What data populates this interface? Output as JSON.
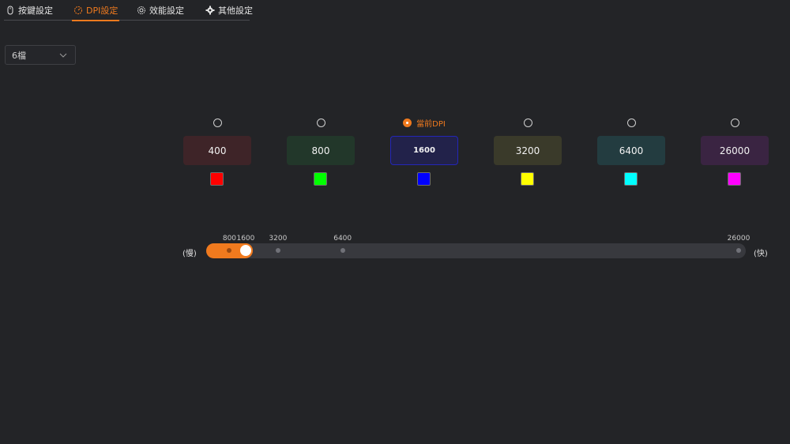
{
  "tabs": [
    {
      "label": "按鍵設定",
      "icon": "mouse-icon",
      "active": false
    },
    {
      "label": "DPI設定",
      "icon": "dpi-gauge-icon",
      "active": true
    },
    {
      "label": "效能設定",
      "icon": "performance-gear-icon",
      "active": false
    },
    {
      "label": "其他設定",
      "icon": "settings-gear-icon",
      "active": false
    }
  ],
  "dropdown": {
    "value": "6檔"
  },
  "current_label": "當前DPI",
  "stages": [
    {
      "value": "400",
      "bg": "#3e2428",
      "swatch": "#ff0000",
      "current": false
    },
    {
      "value": "800",
      "bg": "#22372a",
      "swatch": "#00ff00",
      "current": false
    },
    {
      "value": "1600",
      "bg": "#22224a",
      "swatch": "#0000ff",
      "current": true
    },
    {
      "value": "3200",
      "bg": "#3a3a2a",
      "swatch": "#ffff00",
      "current": false
    },
    {
      "value": "6400",
      "bg": "#233c40",
      "swatch": "#00ffff",
      "current": false
    },
    {
      "value": "26000",
      "bg": "#3a2442",
      "swatch": "#ff00ff",
      "current": false
    }
  ],
  "slider": {
    "slow_label": "(慢)",
    "fast_label": "(快)",
    "min": 0,
    "max": 26000,
    "value": 1600,
    "ticks": [
      {
        "value": 800,
        "label": "800"
      },
      {
        "value": 1600,
        "label": "1600"
      },
      {
        "value": 3200,
        "label": "3200"
      },
      {
        "value": 6400,
        "label": "6400"
      },
      {
        "value": 26000,
        "label": "26000"
      }
    ]
  },
  "colors": {
    "accent": "#f07a1e",
    "background": "#232427"
  }
}
